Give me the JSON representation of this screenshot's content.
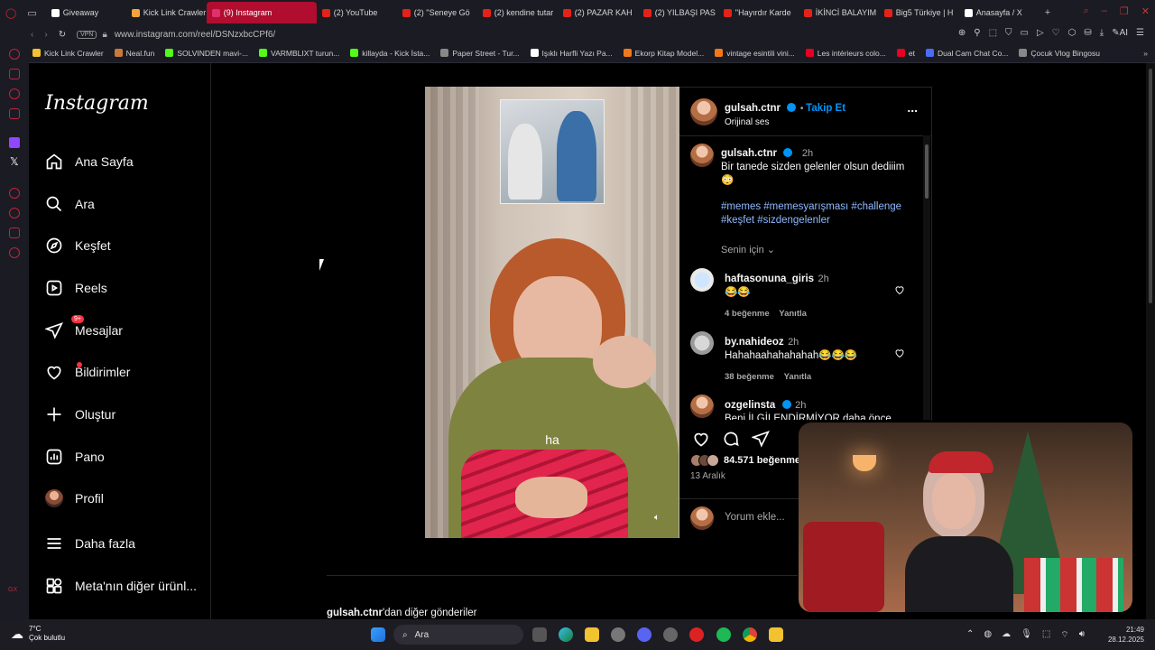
{
  "browser": {
    "tabs": [
      {
        "label": "Giveaway",
        "color": "#ffffff"
      },
      {
        "label": "Kick Link Crawler",
        "color": "#f2a33a"
      },
      {
        "label": "(9) Instagram",
        "active": true,
        "color": "#e1306c"
      },
      {
        "label": "(2) YouTube",
        "color": "#e62117"
      },
      {
        "label": "(2) ''Seneye Gö",
        "color": "#e62117"
      },
      {
        "label": "(2) kendine tutar",
        "color": "#e62117"
      },
      {
        "label": "(2) PAZAR KAH",
        "color": "#e62117"
      },
      {
        "label": "(2) YILBAŞI PAS",
        "color": "#e62117"
      },
      {
        "label": "''Hayırdır Karde",
        "color": "#e62117"
      },
      {
        "label": "İKİNCİ BALAYIM",
        "color": "#e62117"
      },
      {
        "label": "Big5 Türkiye | H",
        "color": "#e62117"
      },
      {
        "label": "Anasayfa / X",
        "color": "#ffffff"
      }
    ],
    "vpn_label": "VPN",
    "url": "www.instagram.com/reel/DSNzxbcCPf6/",
    "ai_label": "AI",
    "bookmarks": [
      {
        "label": "Kick Link Crawler",
        "color": "#f2c230"
      },
      {
        "label": "Neal.fun",
        "color": "#c87a3a"
      },
      {
        "label": "SOLVINDEN mavi-...",
        "color": "#53fc18"
      },
      {
        "label": "VARMBLIXT turun...",
        "color": "#53fc18"
      },
      {
        "label": "killayda - Kick İsta...",
        "color": "#53fc18"
      },
      {
        "label": "Paper Street - Tur...",
        "color": "#888888"
      },
      {
        "label": "Işıklı Harfli Yazı Pa...",
        "color": "#ffffff"
      },
      {
        "label": "Ekorp Kitap Model...",
        "color": "#f07a1a"
      },
      {
        "label": "vintage esintili vini...",
        "color": "#f07a1a"
      },
      {
        "label": "Les intérieurs colo...",
        "color": "#e60023"
      },
      {
        "label": "et",
        "color": "#e60023"
      },
      {
        "label": "Dual Cam Chat Co...",
        "color": "#4a6cf7"
      },
      {
        "label": "Çocuk Vlog Bingosu",
        "color": "#888888"
      }
    ]
  },
  "sidebar": {
    "logo": "Instagram",
    "items": [
      {
        "label": "Ana Sayfa",
        "icon": "home-icon"
      },
      {
        "label": "Ara",
        "icon": "search-icon"
      },
      {
        "label": "Keşfet",
        "icon": "compass-icon"
      },
      {
        "label": "Reels",
        "icon": "reels-icon"
      },
      {
        "label": "Mesajlar",
        "icon": "messages-icon",
        "badge": "9+"
      },
      {
        "label": "Bildirimler",
        "icon": "heart-icon"
      },
      {
        "label": "Oluştur",
        "icon": "plus-icon"
      },
      {
        "label": "Pano",
        "icon": "dashboard-icon"
      },
      {
        "label": "Profil",
        "icon": "avatar"
      },
      {
        "label": "Daha fazla",
        "icon": "menu-icon"
      },
      {
        "label": "Meta'nın diğer ürünl...",
        "icon": "apps-icon"
      }
    ]
  },
  "post": {
    "video_subtitle": "ha",
    "author": "gulsah.ctnr",
    "follow_label": "Takip Et",
    "audio": "Orijinal ses",
    "more_label": "...",
    "caption_author": "gulsah.ctnr",
    "caption_time": "2h",
    "caption_text": "Bir tanede sizden gelenler olsun dediiim",
    "caption_emoji": "😳",
    "hashtags_line1": "#memes #memesyarışması #challenge",
    "hashtags_line2": "#keşfet #sizdengelenler",
    "for_you": "Senin için",
    "comments": [
      {
        "user": "haftasonuna_giris",
        "time": "2h",
        "text": "😂😂",
        "likes": "4 beğenme",
        "reply": "Yanıtla"
      },
      {
        "user": "by.nahideoz",
        "time": "2h",
        "text": "Hahahaahahahahah😂😂😂",
        "likes": "38 beğenme",
        "reply": "Yanıtla"
      },
      {
        "user": "ozgelinsta",
        "time": "2h",
        "text": "Beni İLGİLENDİRMİYOR daha önce",
        "verified": true
      }
    ],
    "like_count": "84.571 beğenme",
    "date": "13 Aralık",
    "comment_placeholder": "Yorum ekle..."
  },
  "more_posts": {
    "user": "gulsah.ctnr",
    "suffix": "'dan diğer gönderiler"
  },
  "taskbar": {
    "weather_temp": "7°C",
    "weather_desc": "Çok bulutlu",
    "search_placeholder": "Ara",
    "time": "21:49",
    "date": "28.12.2025"
  },
  "colors": {
    "accent_blue": "#0095f6",
    "opera_red": "#b00d2f",
    "notification_red": "#ff3040"
  }
}
